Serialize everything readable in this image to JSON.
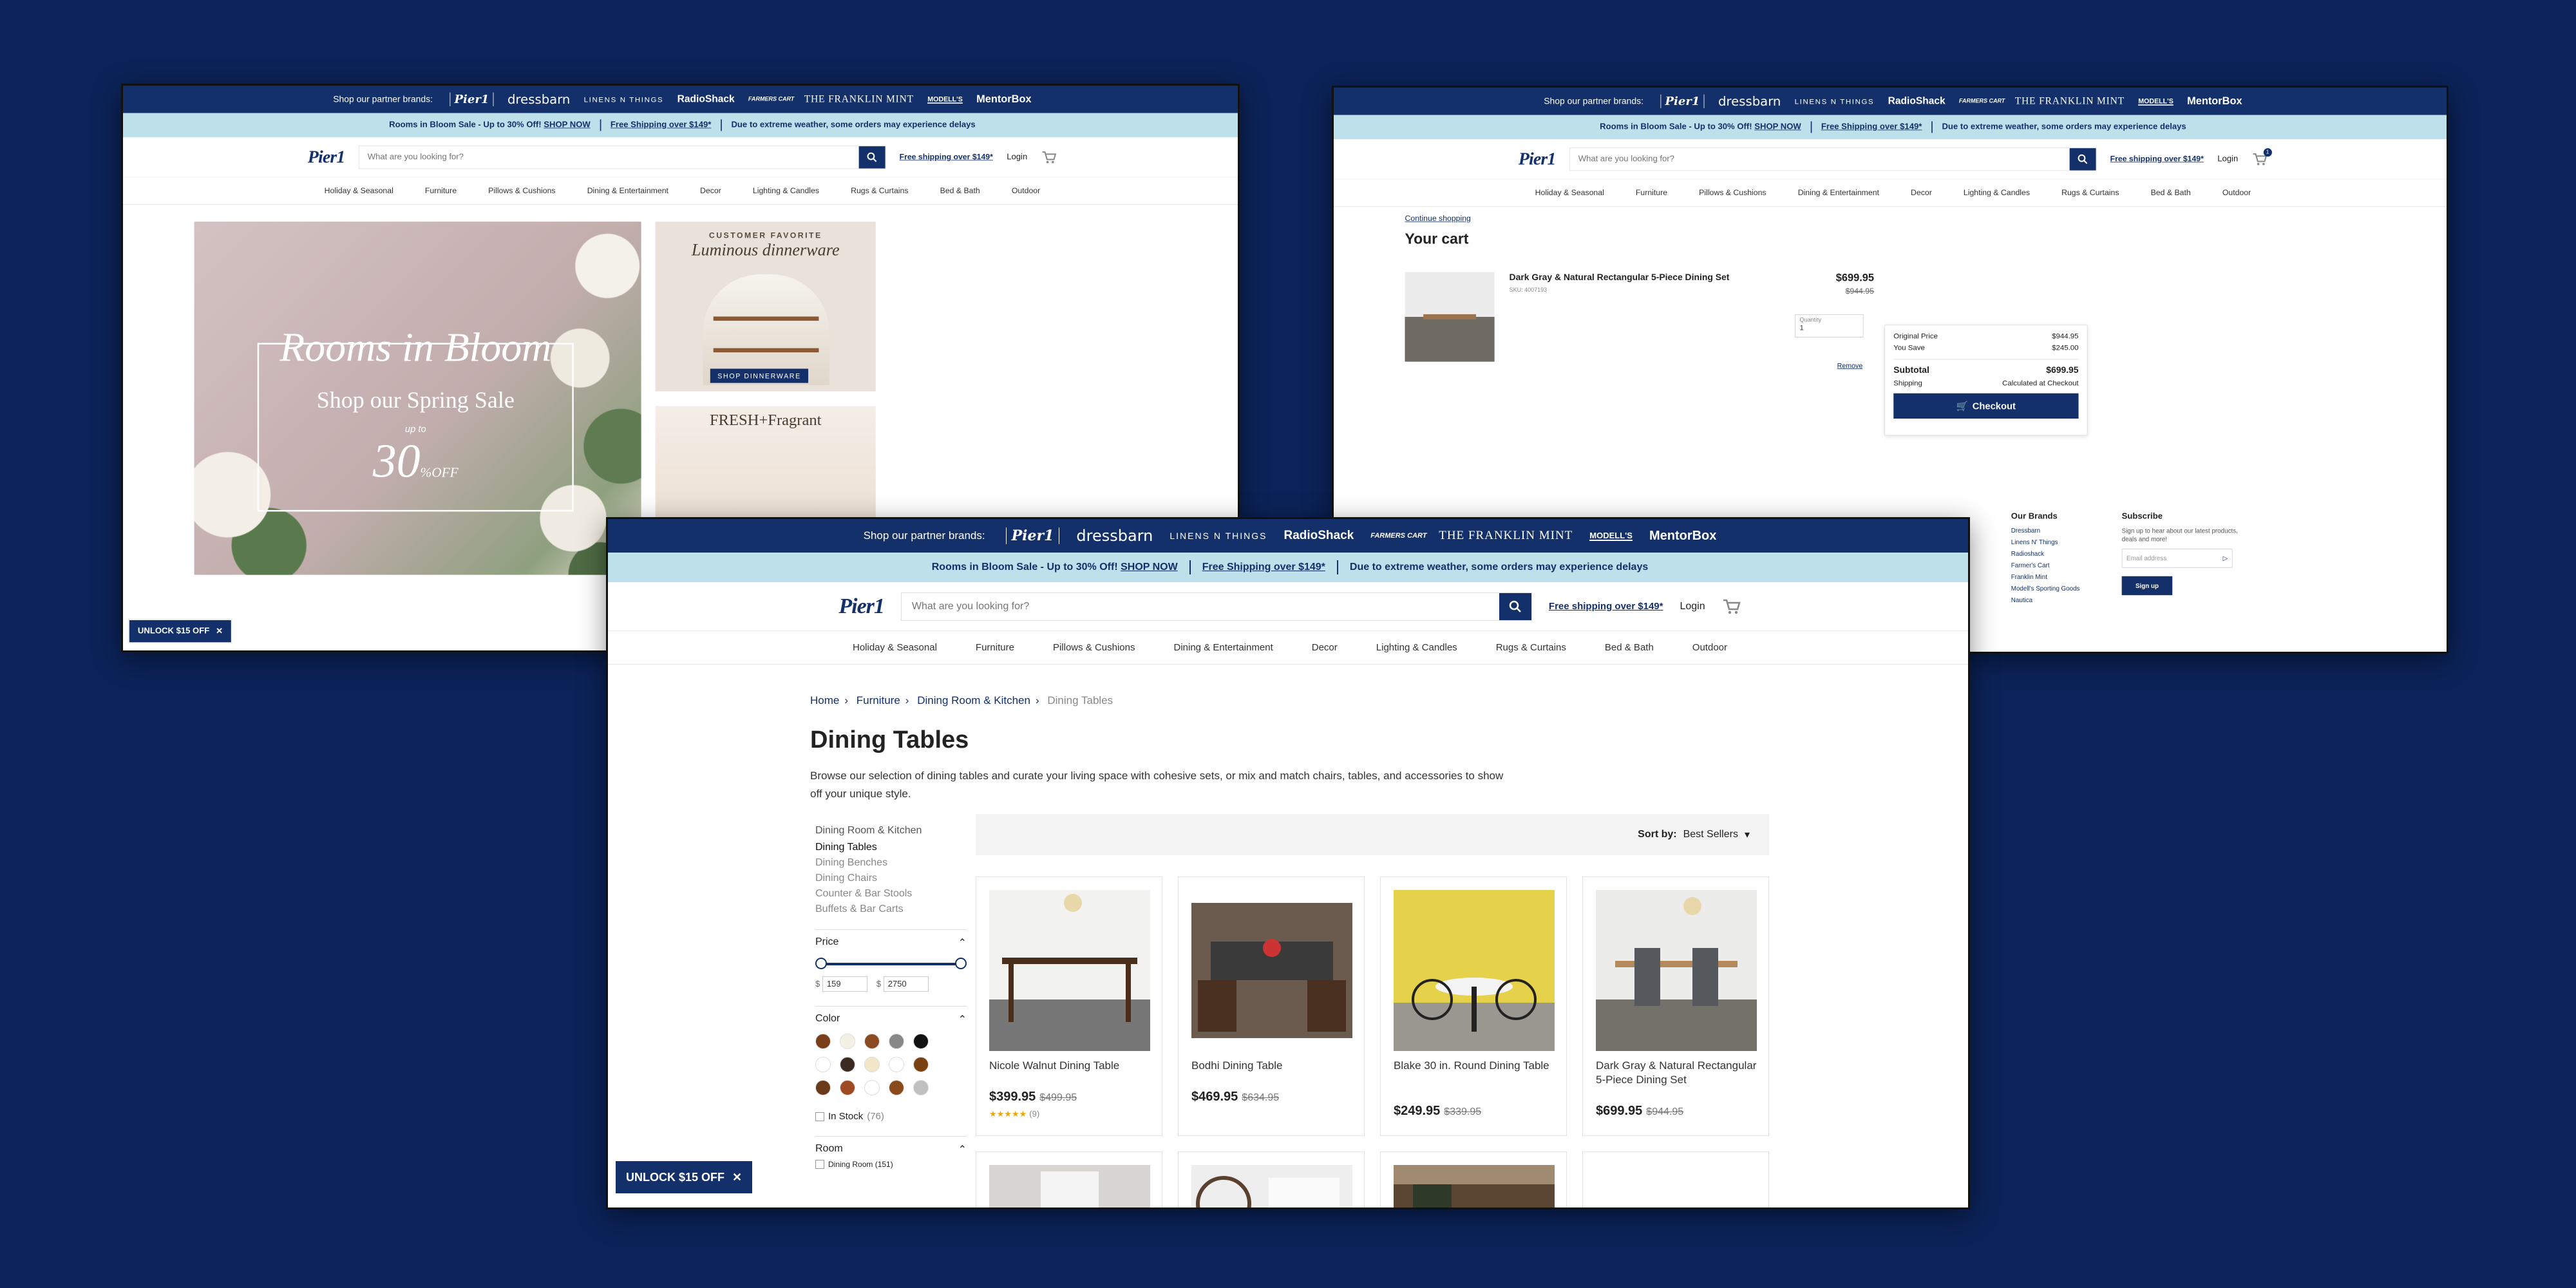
{
  "colors": {
    "page_background": "#0b2358",
    "brand_navy": "#13306a",
    "promo_bg": "#bde0ea"
  },
  "brandbar": {
    "label": "Shop our partner brands:",
    "brands": [
      "Pier1",
      "dressbarn",
      "LINENS N THINGS",
      "RadioShack",
      "FARMERS CART",
      "THE FRANKLIN MINT",
      "MODELL'S",
      "MentorBox"
    ]
  },
  "promobar": {
    "sale": "Rooms in Bloom Sale - Up to 30% Off!",
    "shop_now": "SHOP NOW",
    "shipping": "Free Shipping over $149*",
    "weather": "Due to extreme weather, some orders may experience delays"
  },
  "header": {
    "logo": "Pier1",
    "search_placeholder": "What are you looking for?",
    "free_shipping": "Free shipping over $149*",
    "login": "Login",
    "cart_count": "1"
  },
  "nav": [
    "Holiday & Seasonal",
    "Furniture",
    "Pillows & Cushions",
    "Dining & Entertainment",
    "Decor",
    "Lighting & Candles",
    "Rugs & Curtains",
    "Bed & Bath",
    "Outdoor"
  ],
  "home": {
    "hero": {
      "title": "Rooms in Bloom",
      "subtitle": "Shop our Spring Sale",
      "upto": "up to",
      "percent": "30",
      "pct_sign": "%",
      "off": "OFF"
    },
    "promo1": {
      "kicker": "CUSTOMER FAVORITE",
      "title": "Luminous dinnerware",
      "button": "SHOP DINNERWARE"
    },
    "promo2": {
      "title": "FRESH+Fragrant"
    },
    "unlock": "UNLOCK $15 OFF"
  },
  "cart": {
    "continue": "Continue shopping",
    "title": "Your cart",
    "item": {
      "name": "Dark Gray & Natural Rectangular 5-Piece Dining Set",
      "sku": "SKU: 4007193",
      "price": "$699.95",
      "old_price": "$944.95",
      "qty_label": "Quantity",
      "qty": "1",
      "remove": "Remove"
    },
    "summary": {
      "original_label": "Original Price",
      "original": "$944.95",
      "save_label": "You Save",
      "save": "$245.00",
      "subtotal_label": "Subtotal",
      "subtotal": "$699.95",
      "shipping_label": "Shipping",
      "shipping": "Calculated at Checkout",
      "checkout": "Checkout"
    },
    "footer": {
      "brands_title": "Our Brands",
      "brands": [
        "Dressbarn",
        "Linens N' Things",
        "Radioshack",
        "Farmer's Cart",
        "Franklin Mint",
        "Modell's Sporting Goods",
        "Nautica"
      ],
      "subscribe_title": "Subscribe",
      "subscribe_text": "Sign up to hear about our latest products, deals and more!",
      "email_placeholder": "Email address",
      "signup": "Sign up"
    }
  },
  "listing": {
    "breadcrumbs": [
      "Home",
      "Furniture",
      "Dining Room & Kitchen",
      "Dining Tables"
    ],
    "title": "Dining Tables",
    "description": "Browse our selection of dining tables and curate your living space with cohesive sets, or mix and match chairs, tables, and accessories to show off your unique style.",
    "sidebar": {
      "parent": "Dining Room & Kitchen",
      "subcats": [
        "Dining Tables",
        "Dining Benches",
        "Dining Chairs",
        "Counter & Bar Stools",
        "Buffets & Bar Carts"
      ],
      "price_title": "Price",
      "price_min": "159",
      "price_max": "2750",
      "currency": "$",
      "color_title": "Color",
      "colors": [
        "#7a3e1a",
        "#f5f0e6",
        "#8a4a22",
        "#888888",
        "#111111",
        "#ffffff",
        "#3a2a22",
        "#f2e6c8",
        "#ffffff",
        "#7a4010",
        "#6b3a1a",
        "#a04a22",
        "#ffffff",
        "#8a4a1a",
        "#c0c0c0"
      ],
      "instock": "In Stock",
      "instock_count": "(76)",
      "room_title": "Room",
      "room_option": "Dining Room (151)"
    },
    "sort_label": "Sort by:",
    "sort_value": "Best Sellers",
    "products": [
      {
        "name": "Nicole Walnut Dining Table",
        "price": "$399.95",
        "old": "$499.95",
        "stars": "★★★★★",
        "reviews": "(9)"
      },
      {
        "name": "Bodhi Dining Table",
        "price": "$469.95",
        "old": "$634.95"
      },
      {
        "name": "Blake 30 in. Round Dining Table",
        "price": "$249.95",
        "old": "$339.95"
      },
      {
        "name": "Dark Gray & Natural Rectangular 5-Piece Dining Set",
        "price": "$699.95",
        "old": "$944.95"
      }
    ],
    "unlock": "UNLOCK $15 OFF"
  }
}
